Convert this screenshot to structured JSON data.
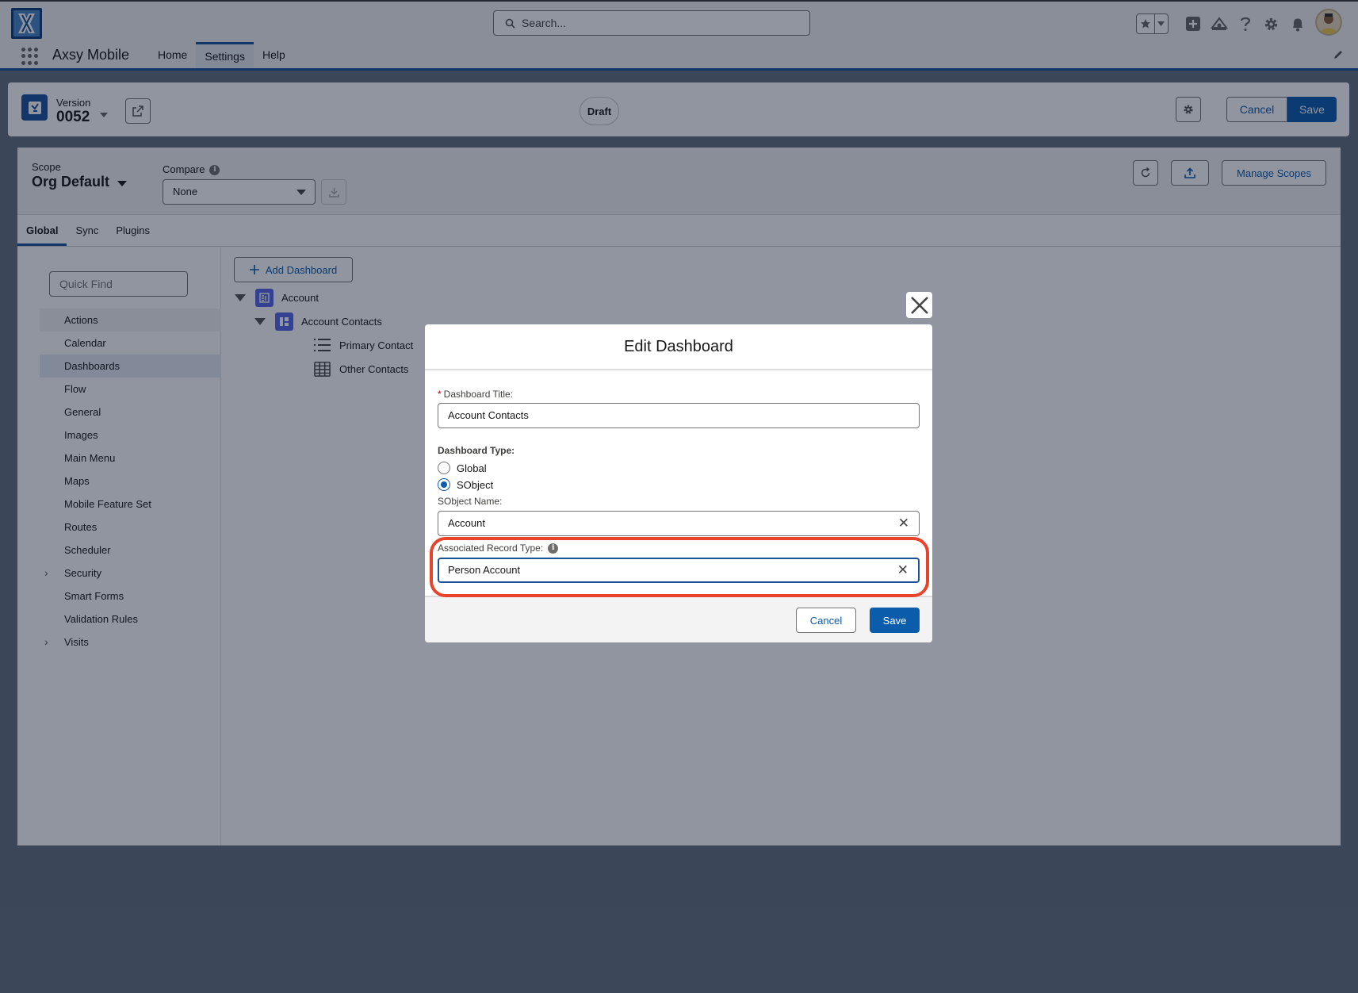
{
  "header": {
    "search_placeholder": "Search..."
  },
  "nav": {
    "app_name": "Axsy Mobile",
    "tabs": [
      {
        "label": "Home"
      },
      {
        "label": "Settings"
      },
      {
        "label": "Help"
      }
    ]
  },
  "version": {
    "label": "Version",
    "number": "0052",
    "status": "Draft",
    "cancel_label": "Cancel",
    "save_label": "Save"
  },
  "scope": {
    "label": "Scope",
    "value": "Org Default",
    "compare_label": "Compare",
    "compare_value": "None",
    "manage_label": "Manage Scopes"
  },
  "tabs": [
    {
      "label": "Global"
    },
    {
      "label": "Sync"
    },
    {
      "label": "Plugins"
    }
  ],
  "sidebar": {
    "quick_find_placeholder": "Quick Find",
    "items": [
      {
        "label": "Actions"
      },
      {
        "label": "Calendar"
      },
      {
        "label": "Dashboards"
      },
      {
        "label": "Flow"
      },
      {
        "label": "General"
      },
      {
        "label": "Images"
      },
      {
        "label": "Main Menu"
      },
      {
        "label": "Maps"
      },
      {
        "label": "Mobile Feature Set"
      },
      {
        "label": "Routes"
      },
      {
        "label": "Scheduler"
      },
      {
        "label": "Security"
      },
      {
        "label": "Smart Forms"
      },
      {
        "label": "Validation Rules"
      },
      {
        "label": "Visits"
      }
    ]
  },
  "content": {
    "add_dashboard_label": "Add Dashboard",
    "tree": [
      {
        "label": "Account"
      },
      {
        "label": "Account Contacts"
      },
      {
        "label": "Primary Contact"
      },
      {
        "label": "Other Contacts"
      }
    ]
  },
  "modal": {
    "title": "Edit Dashboard",
    "required_mark": "*",
    "title_field_label": "Dashboard Title:",
    "title_field_value": "Account Contacts",
    "type_label": "Dashboard Type:",
    "type_options": [
      {
        "label": "Global",
        "checked": false
      },
      {
        "label": "SObject",
        "checked": true
      }
    ],
    "sobject_label": "SObject Name:",
    "sobject_value": "Account",
    "record_type_label": "Associated Record Type:",
    "record_type_value": "Person Account",
    "clear_glyph": "✕",
    "cancel_label": "Cancel",
    "save_label": "Save"
  },
  "colors": {
    "brand": "#1b5297",
    "button": "#0b5cab",
    "highlight": "#e8442c",
    "dashboard_icon": "#5867e8"
  }
}
